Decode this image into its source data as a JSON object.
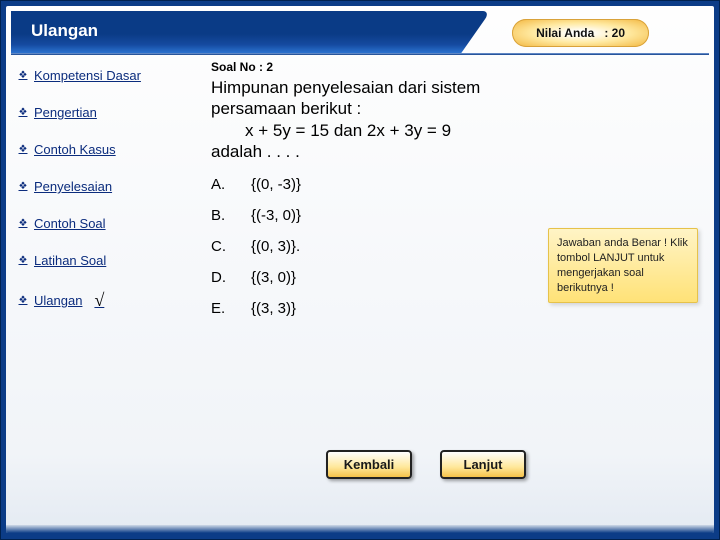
{
  "header": {
    "title": "Ulangan",
    "score_label": "Nilai Anda",
    "score_value": ": 20"
  },
  "sidebar": {
    "items": [
      {
        "label": "Kompetensi Dasar"
      },
      {
        "label": "Pengertian"
      },
      {
        "label": "Contoh Kasus"
      },
      {
        "label": "Penyelesaian"
      },
      {
        "label": "Contoh Soal"
      },
      {
        "label": "Latihan Soal"
      },
      {
        "label": "Ulangan"
      }
    ],
    "check_mark": "√"
  },
  "main": {
    "soal_no_label": "Soal No : 2",
    "question_l1": "Himpunan penyelesaian dari sistem persamaan berikut :",
    "question_eq": "x + 5y = 15 dan 2x + 3y = 9",
    "question_l3": "adalah . . . .",
    "options": {
      "A": {
        "lab": "A.",
        "val": "{(0, -3)}"
      },
      "B": {
        "lab": "B.",
        "val": "{(-3, 0)}"
      },
      "C": {
        "lab": "C.",
        "val": "{(0, 3)}."
      },
      "D": {
        "lab": "D.",
        "val": "{(3, 0)}"
      },
      "E": {
        "lab": "E.",
        "val": "{(3, 3)}"
      }
    },
    "feedback": "Jawaban anda Benar ! Klik tombol LANJUT untuk mengerjakan soal berikutnya !"
  },
  "buttons": {
    "back": "Kembali",
    "next": "Lanjut"
  }
}
